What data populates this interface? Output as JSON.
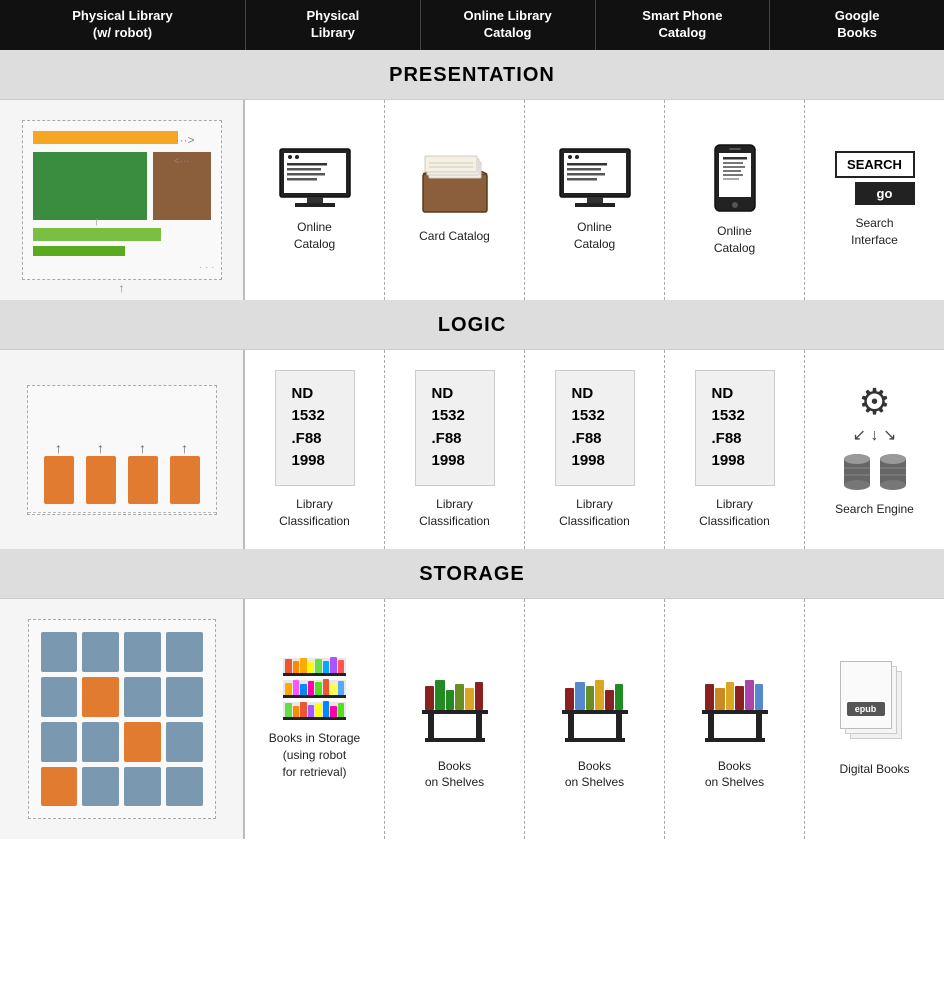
{
  "header": {
    "cols": [
      {
        "label": "Physical Library\n(w/ robot)",
        "sub": ""
      },
      {
        "label": "Physical Library",
        "sub": ""
      },
      {
        "label": "Online Library Catalog",
        "sub": ""
      },
      {
        "label": "Smart Phone Catalog",
        "sub": ""
      },
      {
        "label": "Google Books",
        "sub": ""
      }
    ]
  },
  "sections": {
    "presentation": {
      "label": "PRESENTATION",
      "left_diagram": "library-ui",
      "cols": [
        {
          "icon": "monitor",
          "label": "Online\nCatalog"
        },
        {
          "icon": "card-catalog",
          "label": "Card Catalog"
        },
        {
          "icon": "monitor",
          "label": "Online\nCatalog"
        },
        {
          "icon": "phone",
          "label": "Online\nCatalog"
        },
        {
          "icon": "search-interface",
          "label": "Search\nInterface"
        }
      ]
    },
    "logic": {
      "label": "LOGIC",
      "left_diagram": "book-stacks",
      "cols": [
        {
          "icon": "classification",
          "label": "Library\nClassification",
          "call": "ND\n1532\n.F88\n1998"
        },
        {
          "icon": "classification",
          "label": "Library\nClassification",
          "call": "ND\n1532\n.F88\n1998"
        },
        {
          "icon": "classification",
          "label": "Library\nClassification",
          "call": "ND\n1532\n.F88\n1998"
        },
        {
          "icon": "classification",
          "label": "Library\nClassification",
          "call": "ND\n1532\n.F88\n1998"
        },
        {
          "icon": "search-engine",
          "label": "Search Engine"
        }
      ]
    },
    "storage": {
      "label": "STORAGE",
      "left_diagram": "shelves-grid",
      "cols": [
        {
          "icon": "books-storage",
          "label": "Books in Storage\n(using robot\nfor retrieval)"
        },
        {
          "icon": "books-shelf",
          "label": "Books\non Shelves"
        },
        {
          "icon": "books-shelf",
          "label": "Books\non Shelves"
        },
        {
          "icon": "books-shelf",
          "label": "Books\non Shelves"
        },
        {
          "icon": "digital-books",
          "label": "Digital Books"
        }
      ]
    }
  },
  "colors": {
    "header_bg": "#111111",
    "section_bg": "#dddddd",
    "left_col_bg": "#f5f5f5",
    "orange": "#f5a623",
    "green_dark": "#3a8c3f",
    "green_light": "#7bbf42",
    "brown": "#8B5E3C",
    "book_orange": "#e07b30",
    "shelf_blue": "#7a98b0"
  }
}
